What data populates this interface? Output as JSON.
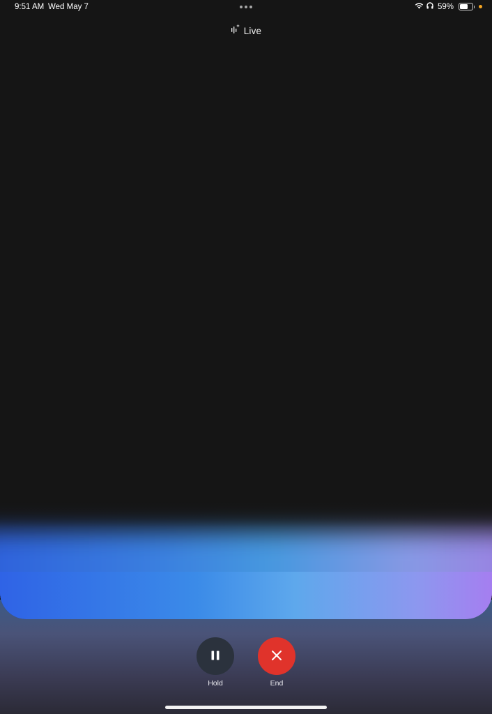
{
  "status_bar": {
    "time": "9:51 AM",
    "date": "Wed May 7",
    "battery": "59%",
    "battery_level": 0.59,
    "icons": [
      "more-dots-icon",
      "wifi-icon",
      "headphones-icon",
      "battery-icon",
      "privacy-indicator-dot"
    ]
  },
  "header": {
    "title": "Live",
    "icon": "live-sparkle-waveform-icon"
  },
  "controls": {
    "hold_label": "Hold",
    "end_label": "End"
  },
  "colors": {
    "background": "#141414",
    "end_button": "#e0332b",
    "hold_button": "#2b323d",
    "glow_left": "#2f63e6",
    "glow_right": "#a57ef0",
    "privacy_dot": "#f5a623"
  }
}
